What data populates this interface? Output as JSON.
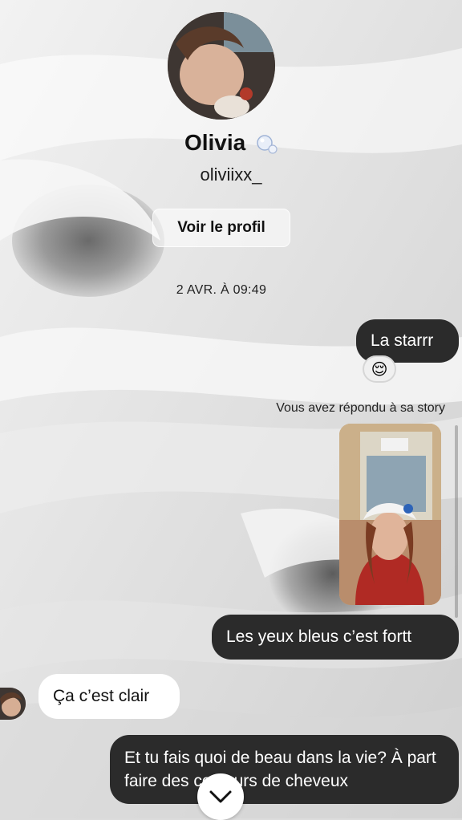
{
  "profile": {
    "name": "Olivia",
    "username": "oliviixx_",
    "view_profile_label": "Voir le profil"
  },
  "thread": {
    "timestamp": "2 AVR. À 09:49",
    "messages": [
      {
        "direction": "out",
        "text": "La starrr",
        "reaction": "😌"
      },
      {
        "direction": "note",
        "text": "Vous avez répondu à sa story"
      },
      {
        "direction": "out",
        "type": "story-image"
      },
      {
        "direction": "out",
        "text": "Les yeux bleus c’est fortt"
      },
      {
        "direction": "in",
        "text": "Ça c’est clair"
      },
      {
        "direction": "out",
        "text": "Et tu fais quoi de beau dans la vie? À part faire des couleurs de cheveux"
      }
    ]
  },
  "icons": {
    "name_badge": "bubbles-icon",
    "scroll": "chevron-down-icon"
  },
  "colors": {
    "outgoing_bubble": "#2b2b2b",
    "incoming_bubble": "#ffffff"
  }
}
